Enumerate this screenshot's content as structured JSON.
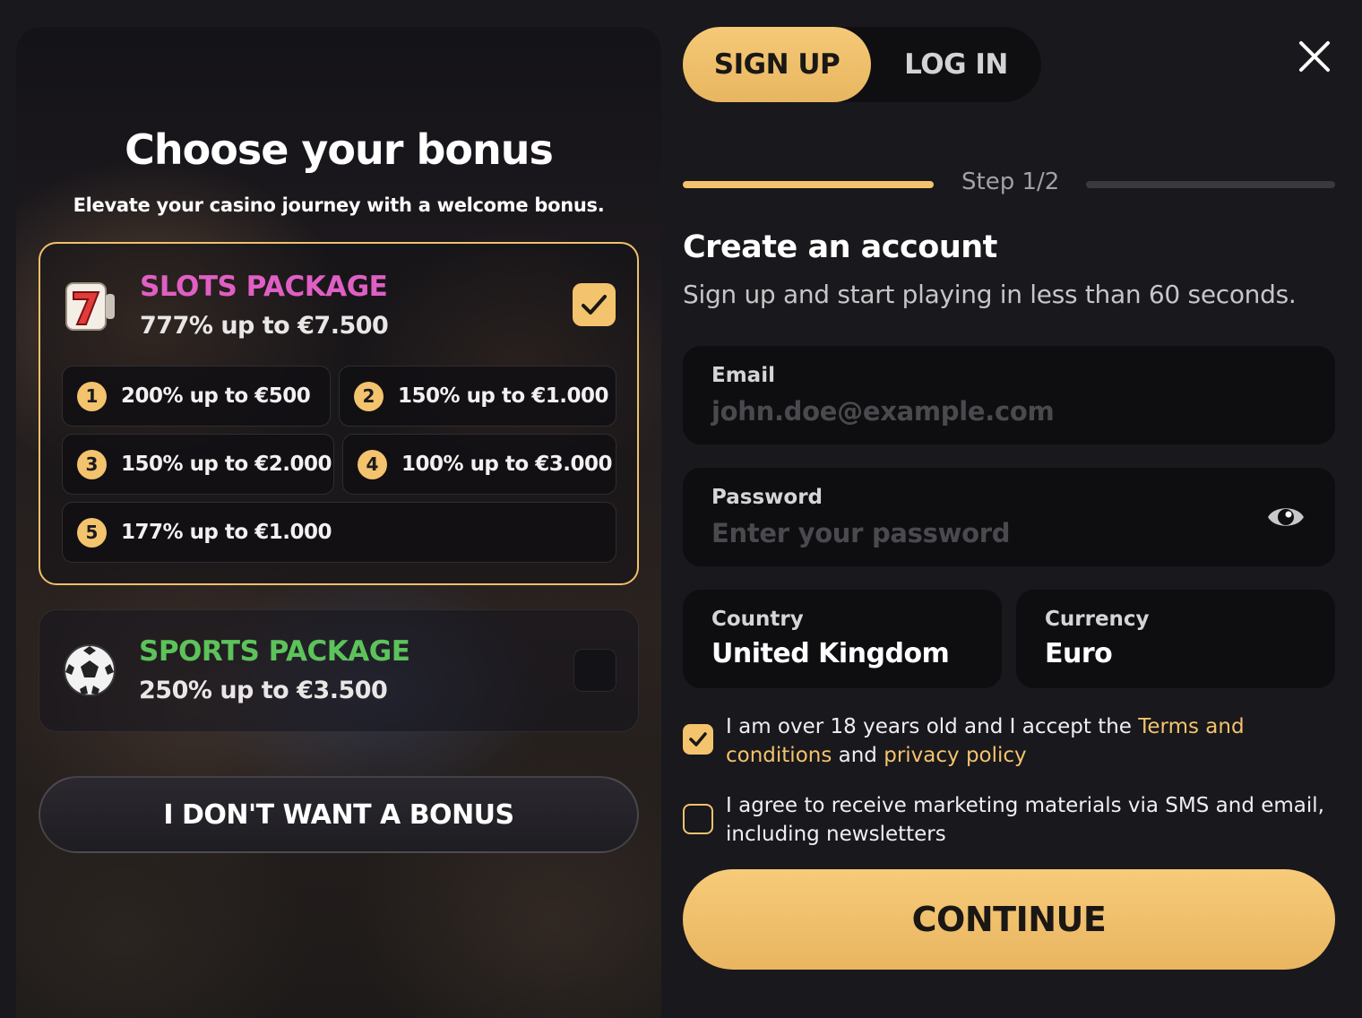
{
  "bonus": {
    "title": "Choose your bonus",
    "subtitle": "Elevate your casino journey with a welcome bonus.",
    "slots": {
      "name": "SLOTS PACKAGE",
      "name_color": "#e05fc4",
      "offer": "777% up to €7.500",
      "selected": true,
      "icon": "slot-seven-icon",
      "tiers": [
        {
          "num": "1",
          "label": "200% up to €500"
        },
        {
          "num": "2",
          "label": "150% up to €1.000"
        },
        {
          "num": "3",
          "label": "150% up to €2.000"
        },
        {
          "num": "4",
          "label": "100% up to €3.000"
        },
        {
          "num": "5",
          "label": "177% up to €1.000"
        }
      ]
    },
    "sports": {
      "name": "SPORTS PACKAGE",
      "name_color": "#5cc35a",
      "offer": "250% up to €3.500",
      "selected": false,
      "icon": "soccer-ball-icon"
    },
    "no_bonus_label": "I DON'T WANT A BONUS"
  },
  "auth": {
    "tabs": [
      {
        "label": "SIGN UP",
        "active": true
      },
      {
        "label": "LOG IN",
        "active": false
      }
    ],
    "close_icon": "close-icon",
    "step": "Step 1/2",
    "step_progress": 0.5,
    "title": "Create an account",
    "subtitle": "Sign up and start playing in less than 60 seconds.",
    "email": {
      "label": "Email",
      "placeholder": "john.doe@example.com"
    },
    "password": {
      "label": "Password",
      "placeholder": "Enter your password",
      "icon": "eye-icon"
    },
    "country": {
      "label": "Country",
      "value": "United Kingdom"
    },
    "currency": {
      "label": "Currency",
      "value": "Euro"
    },
    "terms": {
      "checked": true,
      "text_before": "I am over 18 years old and I accept the ",
      "terms_link": "Terms and conditions",
      "text_middle": " and ",
      "privacy_link": "privacy policy"
    },
    "marketing": {
      "checked": false,
      "text": "I agree to receive marketing materials via SMS and email, including newsletters"
    },
    "continue_label": "CONTINUE"
  },
  "colors": {
    "accent": "#f3c36d",
    "background": "#19181c",
    "field_bg": "#0e0e11"
  }
}
